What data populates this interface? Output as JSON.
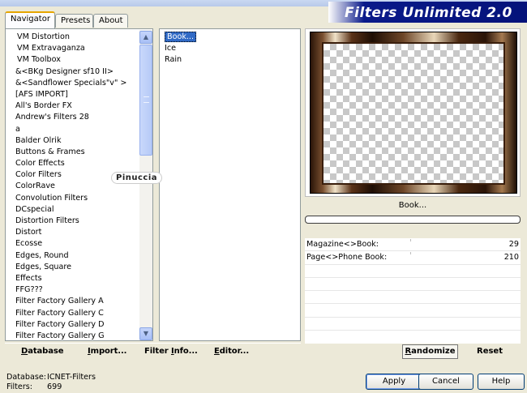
{
  "app": {
    "banner_title": "Filters Unlimited 2.0"
  },
  "tabs": [
    {
      "label": "Navigator",
      "active": true
    },
    {
      "label": "Presets",
      "active": false
    },
    {
      "label": "About",
      "active": false
    }
  ],
  "categories": [
    "VM Distortion",
    "VM Extravaganza",
    "VM Toolbox",
    "&<BKg Designer sf10 II>",
    "&<Sandflower Specials\"v\" >",
    "[AFS IMPORT]",
    "All's Border FX",
    "Andrew's Filters 28",
    "a",
    "Balder Olrik",
    "Buttons & Frames",
    "Color Effects",
    "Color Filters",
    "ColorRave",
    "Convolution Filters",
    "DCspecial",
    "Distortion Filters",
    "Distort",
    "Ecosse",
    "Edges, Round",
    "Edges, Square",
    "Effects",
    "FFG???",
    "Filter Factory Gallery A",
    "Filter Factory Gallery C",
    "Filter Factory Gallery D",
    "Filter Factory Gallery G"
  ],
  "filters": [
    {
      "label": "Book...",
      "selected": true
    },
    {
      "label": "Ice",
      "selected": false
    },
    {
      "label": "Rain",
      "selected": false
    }
  ],
  "watermark": "Pinuccia",
  "preview": {
    "filter_label": "Book..."
  },
  "parameters": [
    {
      "label": "Magazine<>Book:",
      "value": "29"
    },
    {
      "label": "Page<>Phone Book:",
      "value": "210"
    },
    {
      "label": "",
      "value": ""
    },
    {
      "label": "",
      "value": ""
    },
    {
      "label": "",
      "value": ""
    },
    {
      "label": "",
      "value": ""
    },
    {
      "label": "",
      "value": ""
    },
    {
      "label": "",
      "value": ""
    }
  ],
  "bottom_buttons": {
    "database_first": "D",
    "database_rest": "atabase",
    "import_first": "I",
    "import_rest": "mport...",
    "filterinfo_first": "Filter ",
    "filterinfo_u": "I",
    "filterinfo_rest": "nfo...",
    "editor_first": "E",
    "editor_rest": "ditor...",
    "randomize_first": "R",
    "randomize_rest": "andomize",
    "reset": "Reset"
  },
  "status": {
    "database_key": "Database:",
    "database_value": "ICNET-Filters",
    "filters_key": "Filters:",
    "filters_value": "699"
  },
  "dialog_buttons": {
    "apply": "Apply",
    "cancel": "Cancel",
    "help": "Help"
  }
}
